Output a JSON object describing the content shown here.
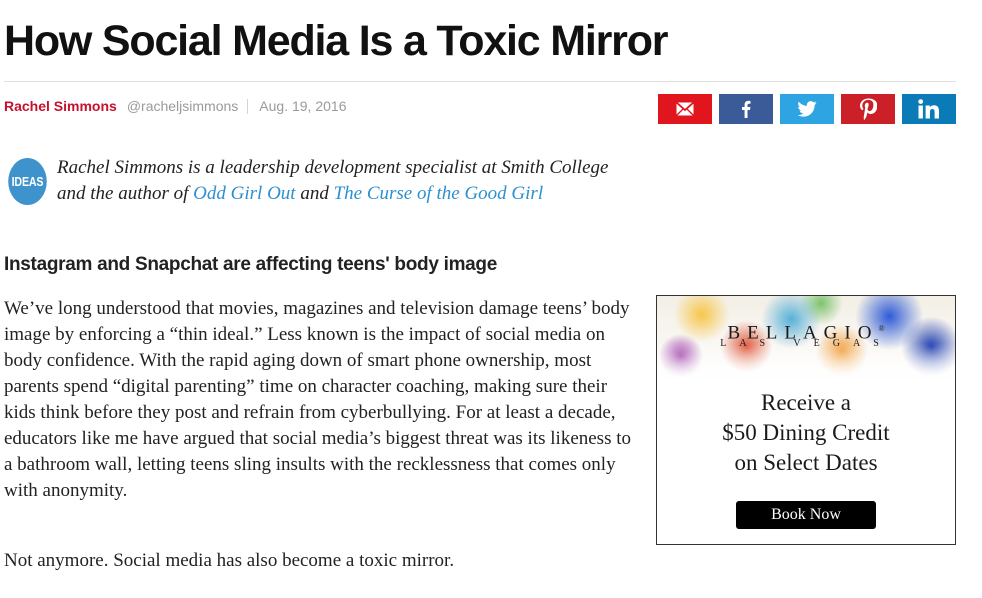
{
  "article": {
    "headline": "How Social Media Is a Toxic Mirror",
    "byline": {
      "author": "Rachel Simmons",
      "handle": "@racheljsimmons",
      "date": "Aug. 19, 2016"
    },
    "badge": "IDEAS",
    "intro": {
      "text_1": "Rachel Simmons is a leadership development specialist at Smith College and the author of ",
      "link_1": "Odd Girl Out",
      "text_2": " and ",
      "link_2": "The Curse of the Good Girl"
    },
    "subhead": "Instagram and Snapchat are affecting teens' body image",
    "paragraphs": [
      "We’ve long understood that movies, magazines and television damage teens’ body image by enforcing a “thin ideal.” Less known is the impact of social media on body confidence. With the rapid aging down of smart phone ownership, most parents spend “digital parenting” time on character coaching, making sure their kids think before they post and refrain from cyberbullying. For at least a decade, educators like me have argued that social media’s biggest threat was its likeness to a bathroom wall, letting teens sling insults with the recklessness that comes only with anonymity.",
      "Not anymore. Social media has also become a toxic mirror."
    ]
  },
  "share": [
    {
      "name": "email",
      "icon": "envelope-icon",
      "color": "#e1151e"
    },
    {
      "name": "facebook",
      "icon": "facebook-icon",
      "color": "#3b5b98"
    },
    {
      "name": "twitter",
      "icon": "twitter-icon",
      "color": "#2ea4e3"
    },
    {
      "name": "pinterest",
      "icon": "pinterest-icon",
      "color": "#cb2027"
    },
    {
      "name": "linkedin",
      "icon": "linkedin-icon",
      "color": "#0a7bb7"
    }
  ],
  "ad": {
    "brand": "BELLAGIO",
    "city": "LAS VEGAS",
    "lines": [
      "Receive a",
      "$50 Dining Credit",
      "on Select Dates"
    ],
    "button": "Book Now"
  },
  "colors": {
    "author": "#c8102e",
    "link": "#2d8fd0",
    "badge": "#3f93cc"
  }
}
